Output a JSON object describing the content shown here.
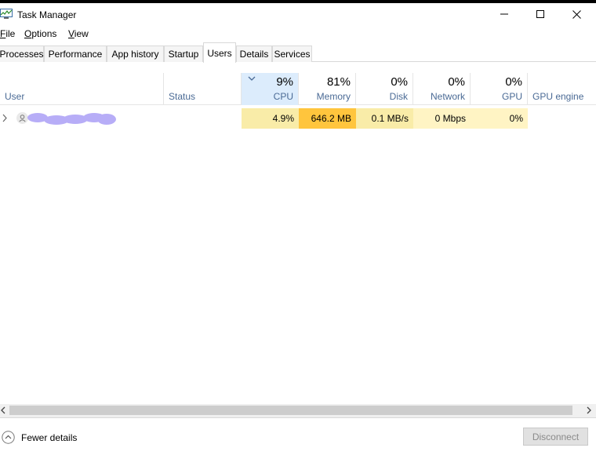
{
  "window": {
    "title": "Task Manager"
  },
  "menu": [
    "File",
    "Options",
    "View"
  ],
  "tabs": [
    "Processes",
    "Performance",
    "App history",
    "Startup",
    "Users",
    "Details",
    "Services"
  ],
  "active_tab": "Users",
  "columns": {
    "user": "User",
    "status": "Status",
    "cpu": {
      "pct": "9%",
      "label": "CPU"
    },
    "memory": {
      "pct": "81%",
      "label": "Memory"
    },
    "disk": {
      "pct": "0%",
      "label": "Disk"
    },
    "network": {
      "pct": "0%",
      "label": "Network"
    },
    "gpu": {
      "pct": "0%",
      "label": "GPU"
    },
    "gpu_engine": "GPU engine"
  },
  "rows": [
    {
      "cpu": "4.9%",
      "memory": "646.2 MB",
      "disk": "0.1 MB/s",
      "network": "0 Mbps",
      "gpu": "0%"
    }
  ],
  "footer": {
    "fewer_details": "Fewer details",
    "disconnect": "Disconnect"
  },
  "colors": {
    "sorted_header": "#dcecfc",
    "heat_light": "#fff4c4",
    "heat_mid": "#f9eca8",
    "heat_strong": "#ffc53d",
    "header_text": "#4a6a95"
  }
}
